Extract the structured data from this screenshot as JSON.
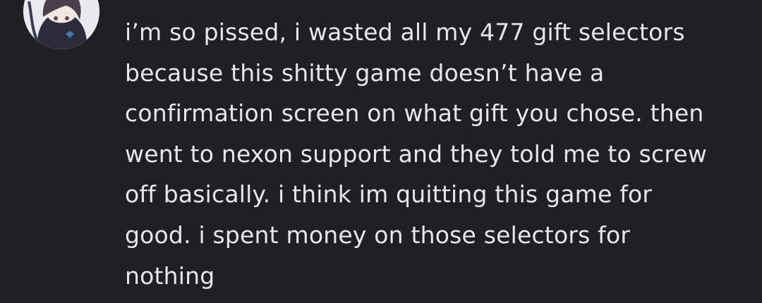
{
  "message": {
    "lines": [
      "i’m so pissed, i wasted all my 477 gift selectors",
      "because this shitty game doesn’t have a",
      "confirmation screen on what gift you chose. then",
      "went to nexon support and they told me to screw",
      "off basically. i think im quitting this game for",
      "good. i spent money on those selectors for",
      "nothing"
    ]
  },
  "colors": {
    "background": "#1f1f24",
    "text": "#e6e7ea"
  }
}
